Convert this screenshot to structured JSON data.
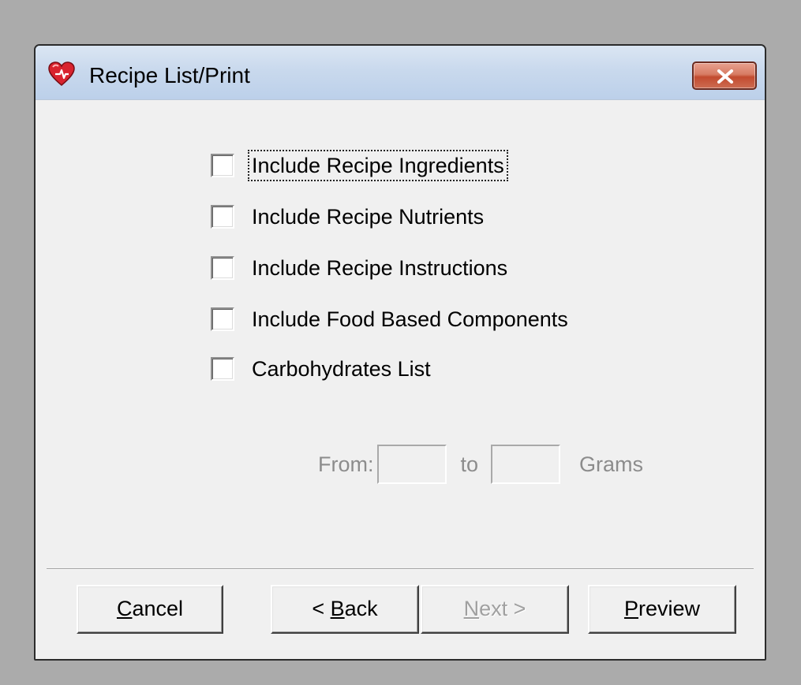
{
  "window": {
    "title": "Recipe List/Print",
    "icon": "heart-icon",
    "close_icon": "close-icon",
    "close_button_color": "#c24b2f"
  },
  "options": [
    {
      "label": "Include Recipe Ingredients",
      "checked": false,
      "focused": true
    },
    {
      "label": "Include Recipe Nutrients",
      "checked": false
    },
    {
      "label": "Include Recipe Instructions",
      "checked": false
    },
    {
      "label": "Include Food Based Components",
      "checked": false
    },
    {
      "label": "Carbohydrates List",
      "checked": false
    }
  ],
  "range": {
    "from_label": "From:",
    "from_value": "",
    "to_label": "to",
    "to_value": "",
    "unit_label": "Grams",
    "enabled": false
  },
  "buttons": {
    "cancel": {
      "mnemonic": "C",
      "rest": "ancel"
    },
    "back": {
      "prefix": "< ",
      "mnemonic": "B",
      "rest": "ack"
    },
    "next": {
      "mnemonic": "N",
      "rest": "ext >",
      "enabled": false
    },
    "preview": {
      "mnemonic": "P",
      "rest": "review"
    }
  }
}
